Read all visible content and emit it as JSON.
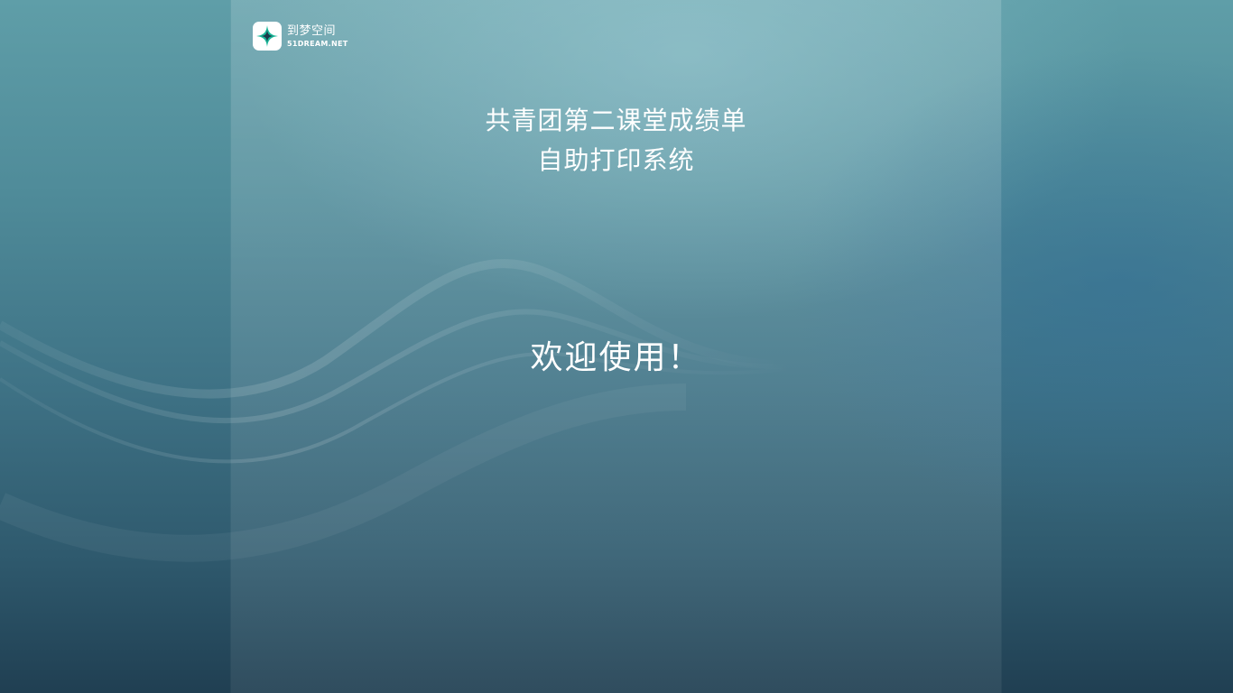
{
  "brand": {
    "name_cn": "到梦空间",
    "name_en": "51DREAM.NET",
    "logo_icon": "four-point-star-icon",
    "logo_color": "#1bb89a"
  },
  "title": {
    "line1": "共青团第二课堂成绩单",
    "line2": "自助打印系统"
  },
  "welcome_text": "欢迎使用！",
  "colors": {
    "background_top": "#5f9ea8",
    "background_bottom": "#203f52",
    "text": "#ffffff"
  }
}
